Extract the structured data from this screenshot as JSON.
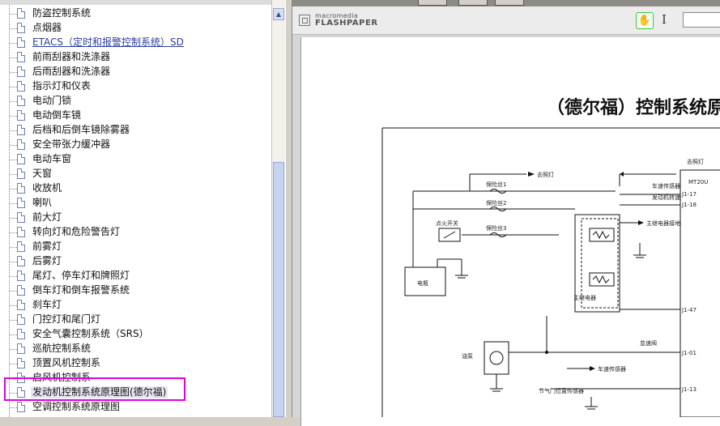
{
  "tree": {
    "items": [
      {
        "label": "防盗控制系统"
      },
      {
        "label": "点烟器"
      },
      {
        "label": "ETACS（定时和报警控制系统）SD"
      },
      {
        "label": "前雨刮器和洗涤器"
      },
      {
        "label": "后雨刮器和洗涤器"
      },
      {
        "label": "指示灯和仪表"
      },
      {
        "label": "电动门锁"
      },
      {
        "label": "电动倒车镜"
      },
      {
        "label": "后档和后倒车镜除雾器"
      },
      {
        "label": "安全带张力缓冲器"
      },
      {
        "label": "电动车窗"
      },
      {
        "label": "天窗"
      },
      {
        "label": "收放机"
      },
      {
        "label": "喇叭"
      },
      {
        "label": "前大灯"
      },
      {
        "label": "转向灯和危险警告灯"
      },
      {
        "label": "前雾灯"
      },
      {
        "label": "后雾灯"
      },
      {
        "label": "尾灯、停车灯和牌照灯"
      },
      {
        "label": "倒车灯和倒车报警系统"
      },
      {
        "label": "刹车灯"
      },
      {
        "label": "门控灯和尾门灯"
      },
      {
        "label": "安全气囊控制系统（SRS）"
      },
      {
        "label": "巡航控制系统"
      },
      {
        "label": "顶置风机控制系"
      },
      {
        "label": "启风机控制系"
      },
      {
        "label": "发动机控制系统原理图(德尔福)"
      },
      {
        "label": "空调控制系统原理图"
      }
    ],
    "selected_index": 26
  },
  "viewer": {
    "brand_line1": "macromedia",
    "brand_line2": "FLASHPAPER",
    "hand_tool_icon": "hand-icon",
    "select_tool_icon": "text-select-icon"
  },
  "document": {
    "title": "（德尔福）控制系统原",
    "diagram_labels": {
      "fuse1": "保险丝1",
      "fuse2": "保险丝2",
      "fuse3": "保险丝3",
      "ignition": "点火开关",
      "battery": "电瓶",
      "relay": "主继电器",
      "main_relay": "主继电器接地",
      "fuel_pump": "油泵",
      "ecu": "MT20U",
      "to_light": "去照灯",
      "speed": "车速传感器",
      "engine": "发动机转速",
      "idle": "怠速阀",
      "sensor": "节气门位置传感器",
      "pin_j1_17": "J1-17",
      "pin_j1_18": "J1-18",
      "pin_j1_47": "J1-47",
      "pin_j1_01": "J1-01",
      "pin_j1_13": "J1-13"
    }
  }
}
